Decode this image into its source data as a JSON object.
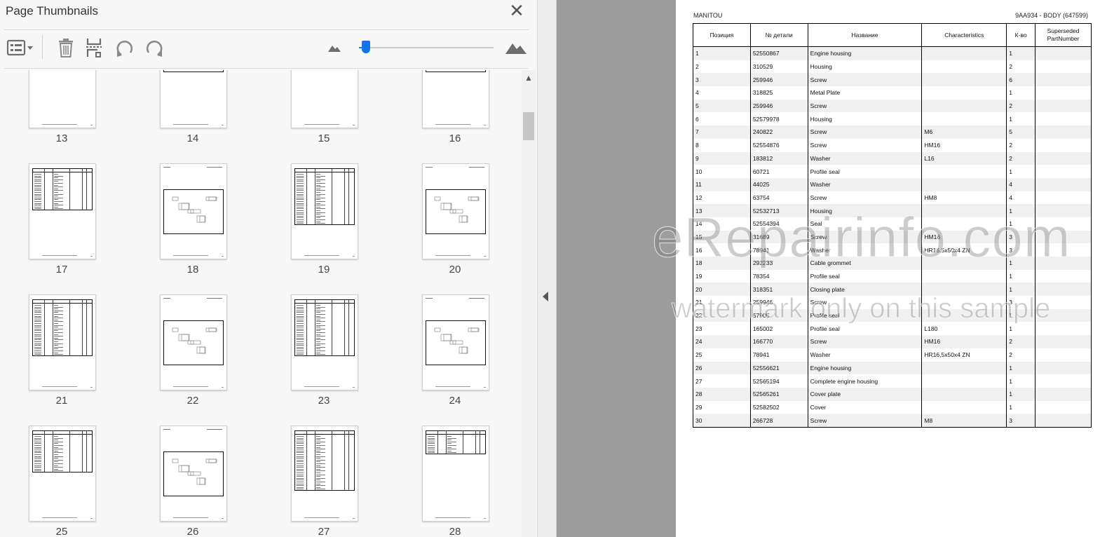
{
  "panel": {
    "title": "Page Thumbnails",
    "close_icon": "close-icon",
    "toolbar": [
      "thumbnail-options-icon",
      "delete-page-icon",
      "insert-page-icon",
      "rotate-counterclockwise-icon",
      "rotate-clockwise-icon"
    ],
    "zoom": {
      "min_icon": "small-mountain-icon",
      "max_icon": "large-mountain-icon",
      "level": 0.05
    },
    "thumbnails": [
      {
        "page": "13",
        "kind": "table-partial",
        "rows": 0
      },
      {
        "page": "14",
        "kind": "parts-drawing",
        "rows": 0
      },
      {
        "page": "15",
        "kind": "table-partial",
        "rows": 0
      },
      {
        "page": "16",
        "kind": "parts-drawing",
        "rows": 0
      },
      {
        "page": "17",
        "kind": "table",
        "rows": 20
      },
      {
        "page": "18",
        "kind": "drawing",
        "rows": 0
      },
      {
        "page": "19",
        "kind": "table",
        "rows": 28
      },
      {
        "page": "20",
        "kind": "drawing",
        "rows": 0
      },
      {
        "page": "21",
        "kind": "table",
        "rows": 28
      },
      {
        "page": "22",
        "kind": "drawing",
        "rows": 0
      },
      {
        "page": "23",
        "kind": "table",
        "rows": 28
      },
      {
        "page": "24",
        "kind": "drawing",
        "rows": 0
      },
      {
        "page": "25",
        "kind": "table",
        "rows": 20
      },
      {
        "page": "26",
        "kind": "drawing",
        "rows": 0
      },
      {
        "page": "27",
        "kind": "table",
        "rows": 30
      },
      {
        "page": "28",
        "kind": "table-short",
        "rows": 10
      }
    ]
  },
  "document": {
    "manufacturer": "MANITOU",
    "reference": "9AA934 - BODY (647599)",
    "headers": [
      "Позиция",
      "№ детали",
      "Название",
      "Characteristics",
      "К-во",
      "Superseded PartNumber"
    ],
    "rows": [
      [
        "1",
        "52550867",
        "Engine housing",
        "",
        "1",
        ""
      ],
      [
        "2",
        "310529",
        "Housing",
        "",
        "2",
        ""
      ],
      [
        "3",
        "259946",
        "Screw",
        "",
        "6",
        ""
      ],
      [
        "4",
        "318825",
        "Metal Plate",
        "",
        "1",
        ""
      ],
      [
        "5",
        "259946",
        "Screw",
        "",
        "2",
        ""
      ],
      [
        "6",
        "52579978",
        "Housing",
        "",
        "1",
        ""
      ],
      [
        "7",
        "240822",
        "Screw",
        "M6",
        "5",
        ""
      ],
      [
        "8",
        "52554876",
        "Screw",
        "HM16",
        "2",
        ""
      ],
      [
        "9",
        "183812",
        "Washer",
        "L16",
        "2",
        ""
      ],
      [
        "10",
        "60721",
        "Profile seal",
        "",
        "1",
        ""
      ],
      [
        "11",
        "44025",
        "Washer",
        "",
        "4",
        ""
      ],
      [
        "12",
        "63754",
        "Screw",
        "HM8",
        "4",
        ""
      ],
      [
        "13",
        "52532713",
        "Housing",
        "",
        "1",
        ""
      ],
      [
        "14",
        "52554394",
        "Seal",
        "",
        "1",
        ""
      ],
      [
        "15",
        "31689",
        "Screw",
        "HM16",
        "3",
        ""
      ],
      [
        "16",
        "78941",
        "Washer",
        "HR16,5x50x4 ZN",
        "3",
        ""
      ],
      [
        "18",
        "292233",
        "Cable grommet",
        "",
        "1",
        ""
      ],
      [
        "19",
        "78354",
        "Profile seal",
        "",
        "1",
        ""
      ],
      [
        "20",
        "318351",
        "Closing plate",
        "",
        "1",
        ""
      ],
      [
        "21",
        "259946",
        "Screw",
        "",
        "3",
        ""
      ],
      [
        "22",
        "57905",
        "Profile seal",
        "",
        "1",
        ""
      ],
      [
        "23",
        "165002",
        "Profile seal",
        "L180",
        "1",
        ""
      ],
      [
        "24",
        "166770",
        "Screw",
        "HM16",
        "2",
        ""
      ],
      [
        "25",
        "78941",
        "Washer",
        "HR16,5x50x4 ZN",
        "2",
        ""
      ],
      [
        "26",
        "52556621",
        "Engine housing",
        "",
        "1",
        ""
      ],
      [
        "27",
        "52565194",
        "Complete engine housing",
        "",
        "1",
        ""
      ],
      [
        "28",
        "52565261",
        "Cover plate",
        "",
        "1",
        ""
      ],
      [
        "29",
        "52582502",
        "Cover",
        "",
        "1",
        ""
      ],
      [
        "30",
        "266728",
        "Screw",
        "M8",
        "3",
        ""
      ]
    ]
  },
  "watermark": {
    "line1": "eRepairinfo.com",
    "line2": "watermark only on this sample"
  },
  "colors": {
    "accent": "#1473e6",
    "panel_bg": "#f7f7f7",
    "viewer_bg": "#9c9c9c"
  }
}
